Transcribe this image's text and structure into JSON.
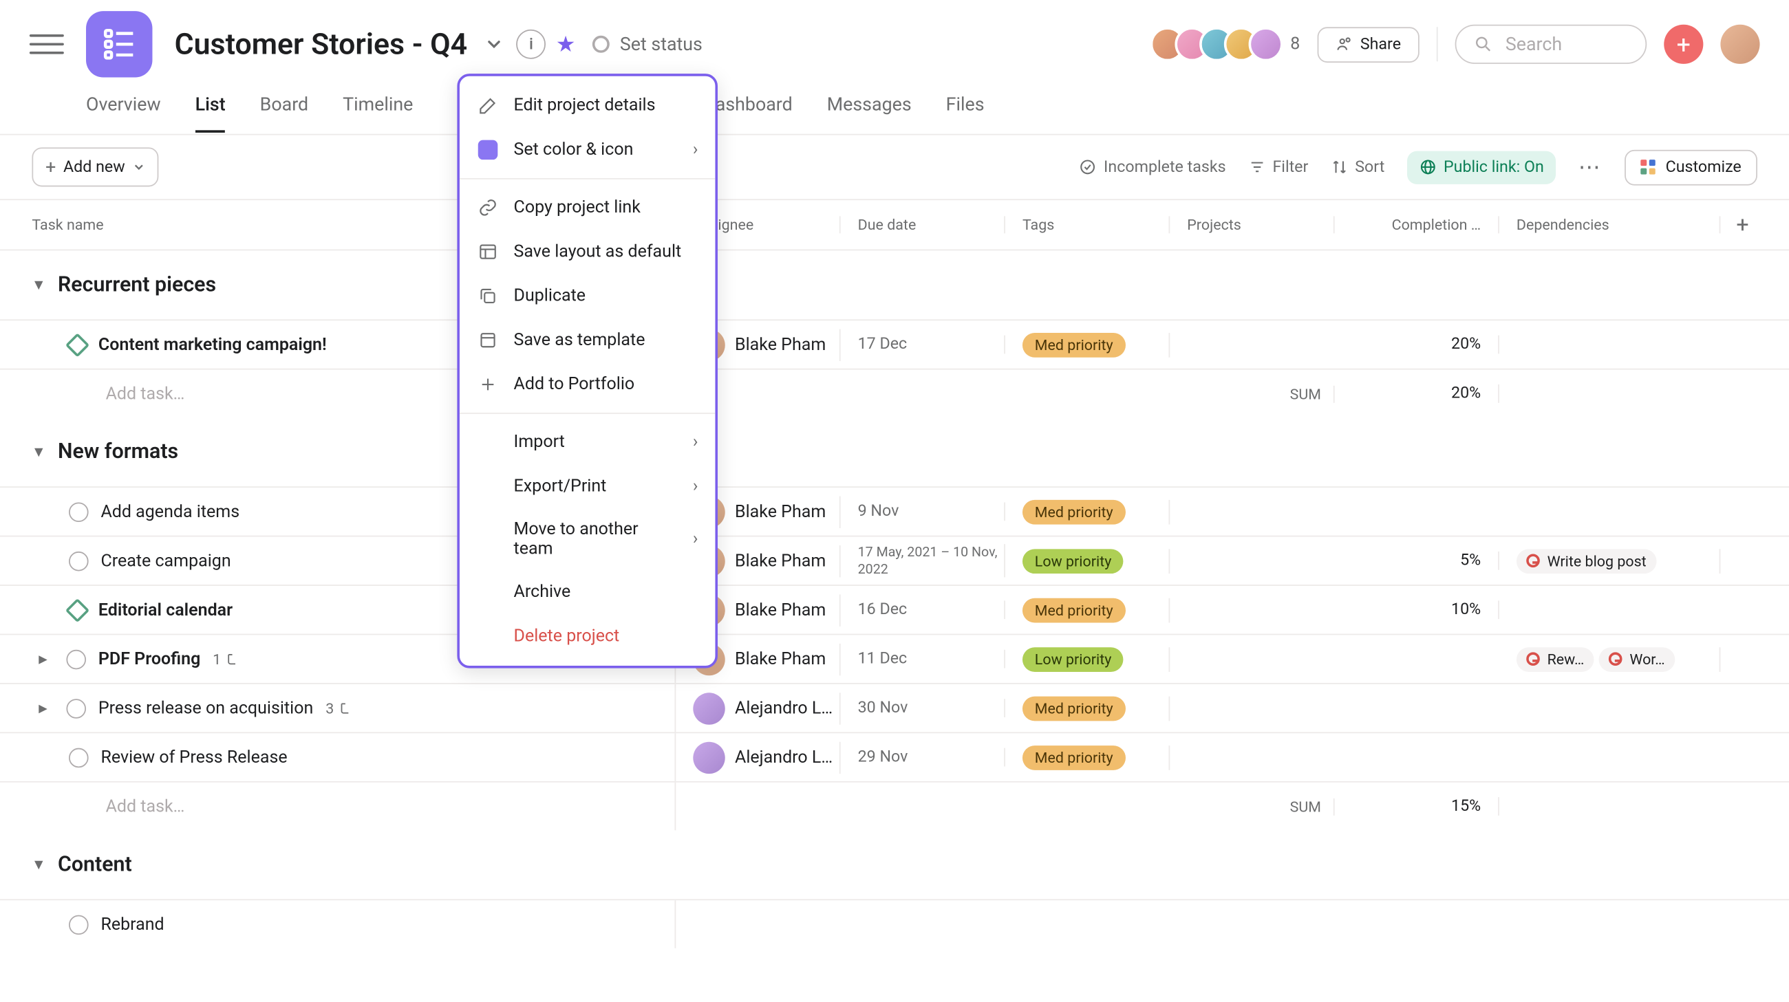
{
  "header": {
    "title": "Customer Stories - Q4",
    "set_status": "Set status",
    "avatar_more": "8",
    "share": "Share",
    "search_placeholder": "Search"
  },
  "tabs": [
    "Overview",
    "List",
    "Board",
    "Timeline",
    "Dashboard",
    "Messages",
    "Files"
  ],
  "tabs_partial_visible": "ashboard",
  "toolbar": {
    "add_new": "Add new",
    "incomplete": "Incomplete tasks",
    "filter": "Filter",
    "sort": "Sort",
    "public_link": "Public link: On",
    "customize": "Customize"
  },
  "columns": {
    "task": "Task name",
    "assignee": "Assignee",
    "due": "Due date",
    "tags": "Tags",
    "projects": "Projects",
    "completion": "Completion …",
    "deps": "Dependencies"
  },
  "sections": {
    "s1": {
      "title": "Recurrent pieces",
      "sum_label": "SUM",
      "sum_value": "20%",
      "tasks": [
        {
          "name": "Content marketing campaign!",
          "type": "milestone",
          "bold": true,
          "assignee": "Blake Pham",
          "av": "ma1",
          "due": "17 Dec",
          "tag": "Med priority",
          "tagc": "med",
          "completion": "20%"
        }
      ]
    },
    "s2": {
      "title": "New formats",
      "sum_label": "SUM",
      "sum_value": "15%",
      "tasks": [
        {
          "name": "Add agenda items",
          "type": "check",
          "assignee": "Blake Pham",
          "av": "ma1",
          "due": "9 Nov",
          "tag": "Med priority",
          "tagc": "med"
        },
        {
          "name": "Create campaign",
          "type": "check",
          "assignee": "Blake Pham",
          "av": "ma1",
          "due": "17 May, 2021 – 10 Nov, 2022",
          "due2": true,
          "tag": "Low priority",
          "tagc": "low",
          "completion": "5%",
          "deps": [
            {
              "label": "Write blog post"
            }
          ]
        },
        {
          "name": "Editorial calendar",
          "type": "milestone",
          "bold": true,
          "assignee": "Blake Pham",
          "av": "ma1",
          "due": "16 Dec",
          "tag": "Med priority",
          "tagc": "med",
          "completion": "10%"
        },
        {
          "name": "PDF Proofing",
          "type": "check",
          "bold": true,
          "expand": true,
          "sub": "1",
          "assignee": "Blake Pham",
          "av": "ma1",
          "due": "11 Dec",
          "tag": "Low priority",
          "tagc": "low",
          "deps": [
            {
              "label": "Rew…"
            },
            {
              "label": "Wor…"
            }
          ]
        },
        {
          "name": "Press release on acquisition",
          "type": "check",
          "expand": true,
          "sub": "3",
          "assignee": "Alejandro L…",
          "av": "ma2",
          "due": "30 Nov",
          "tag": "Med priority",
          "tagc": "med"
        },
        {
          "name": "Review of Press Release",
          "type": "check",
          "assignee": "Alejandro L…",
          "av": "ma2",
          "due": "29 Nov",
          "tag": "Med priority",
          "tagc": "med"
        }
      ]
    },
    "s3": {
      "title": "Content",
      "tasks": [
        {
          "name": "Rebrand",
          "type": "check"
        }
      ]
    }
  },
  "add_task": "Add task…",
  "ctx": {
    "edit": "Edit project details",
    "color": "Set color & icon",
    "copy": "Copy project link",
    "layout": "Save layout as default",
    "duplicate": "Duplicate",
    "template": "Save as template",
    "portfolio": "Add to Portfolio",
    "import": "Import",
    "export": "Export/Print",
    "move": "Move to another team",
    "archive": "Archive",
    "delete": "Delete project"
  }
}
